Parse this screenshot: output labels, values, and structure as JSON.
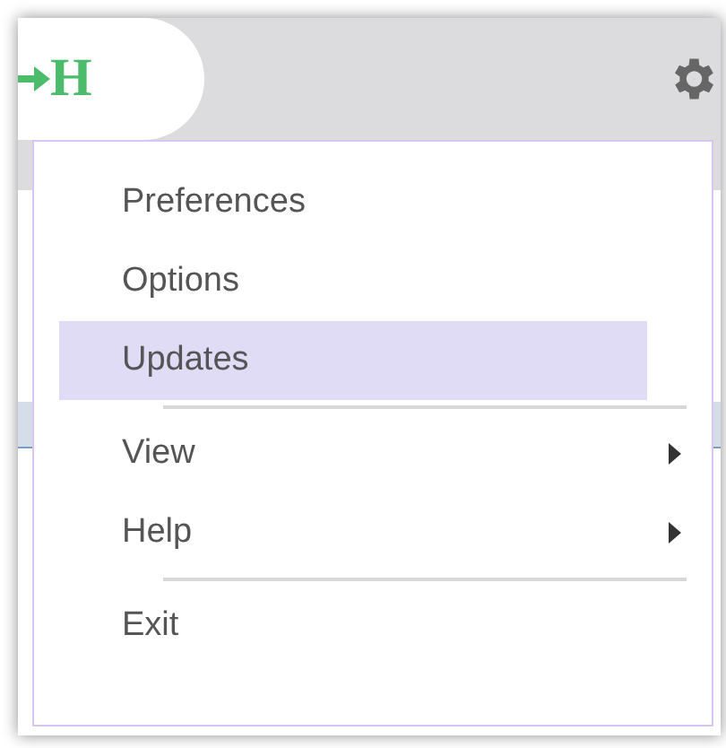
{
  "header": {
    "logo": {
      "letter": "H"
    }
  },
  "menu": {
    "items": [
      {
        "kind": "item",
        "label": "Preferences",
        "selected": false,
        "submenu": false
      },
      {
        "kind": "item",
        "label": "Options",
        "selected": false,
        "submenu": false
      },
      {
        "kind": "item",
        "label": "Updates",
        "selected": true,
        "submenu": false
      },
      {
        "kind": "separator"
      },
      {
        "kind": "item",
        "label": "View",
        "selected": false,
        "submenu": true
      },
      {
        "kind": "item",
        "label": "Help",
        "selected": false,
        "submenu": true
      },
      {
        "kind": "separator"
      },
      {
        "kind": "item",
        "label": "Exit",
        "selected": false,
        "submenu": false
      }
    ]
  }
}
